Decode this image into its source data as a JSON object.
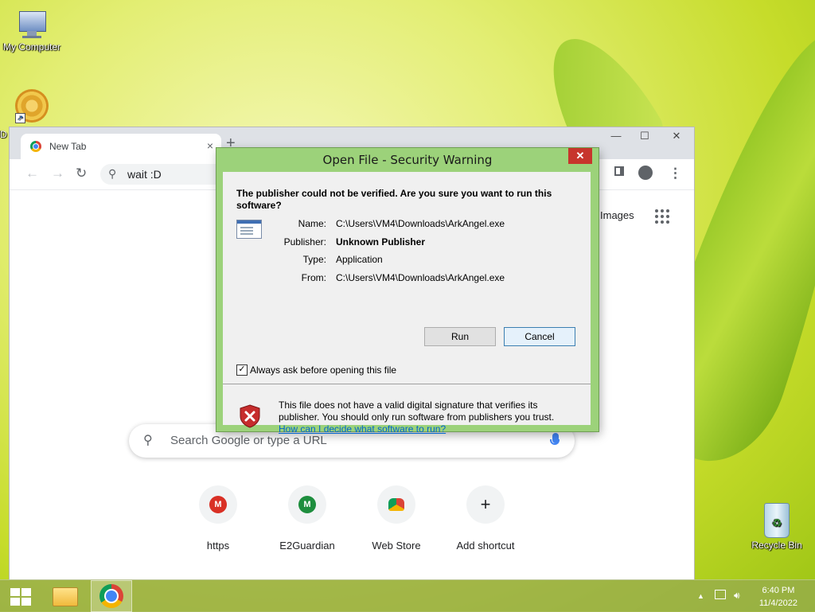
{
  "desktop": {
    "icons": [
      {
        "label": "My Computer"
      },
      {
        "label": "D"
      },
      {
        "label": "Recycle Bin"
      }
    ]
  },
  "browser": {
    "tab_title": "New Tab",
    "tab_close": "×",
    "new_tab": "+",
    "window_controls": {
      "minimize": "—",
      "maximize": "☐",
      "close": "✕"
    },
    "address": "wait :D",
    "images_link": "Images",
    "search_placeholder": "Search Google or type a URL",
    "shortcuts": [
      {
        "label": "https",
        "letter": "M",
        "color": "#d93025"
      },
      {
        "label": "E2Guardian",
        "letter": "M",
        "color": "#1e8e3e"
      },
      {
        "label": "Web Store",
        "letter": "",
        "color": "#4285f4"
      },
      {
        "label": "Add shortcut",
        "letter": "+",
        "color": "#f1f3f4"
      }
    ]
  },
  "dialog": {
    "title": "Open File - Security Warning",
    "close": "✕",
    "question": "The publisher could not be verified.  Are you sure you want to run this software?",
    "fields": [
      {
        "label": "Name:",
        "value": "C:\\Users\\VM4\\Downloads\\ArkAngel.exe"
      },
      {
        "label": "Publisher:",
        "value": "Unknown Publisher"
      },
      {
        "label": "Type:",
        "value": "Application"
      },
      {
        "label": "From:",
        "value": "C:\\Users\\VM4\\Downloads\\ArkAngel.exe"
      }
    ],
    "run_label": "Run",
    "cancel_label": "Cancel",
    "checkbox_label": "Always ask before opening this file",
    "checkbox_checked": true,
    "checkbox_mark": "✓",
    "warning_text": "This file does not have a valid digital signature that verifies its publisher.  You should only run software from publishers you trust.",
    "help_link": "How can I decide what software to run?"
  },
  "taskbar": {
    "time": "6:40 PM",
    "date": "11/4/2022",
    "tray_up": "▲"
  }
}
